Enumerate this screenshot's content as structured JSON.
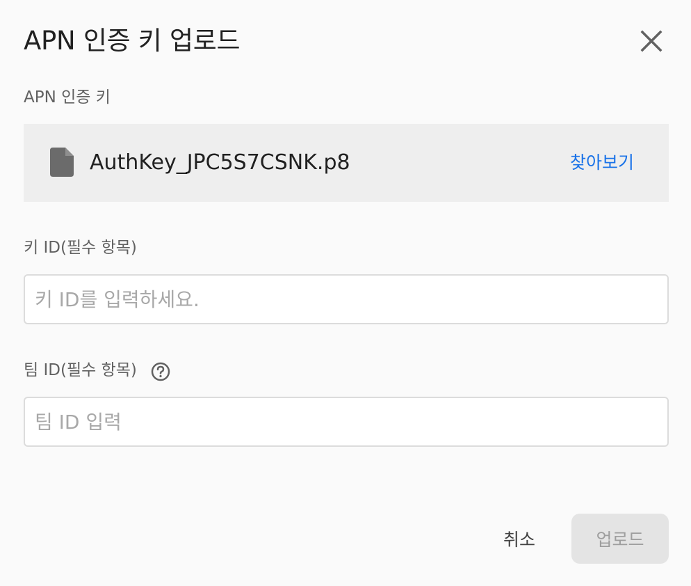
{
  "dialog": {
    "title": "APN 인증 키 업로드"
  },
  "auth_key": {
    "label": "APN 인증 키",
    "file_name": "AuthKey_JPC5S7CSNK.p8",
    "browse_label": "찾아보기"
  },
  "key_id": {
    "label": "키 ID(필수 항목)",
    "value": "",
    "placeholder": "키 ID를 입력하세요."
  },
  "team_id": {
    "label": "팀 ID(필수 항목)",
    "value": "",
    "placeholder": "팀 ID 입력"
  },
  "actions": {
    "cancel_label": "취소",
    "upload_label": "업로드",
    "upload_enabled": false
  },
  "icons": {
    "close": "close-icon",
    "file": "file-icon",
    "help": "help-circle-icon"
  },
  "colors": {
    "link": "#1a73e8",
    "file_box_bg": "#eeeeee",
    "disabled_button_bg": "#e4e4e4"
  }
}
